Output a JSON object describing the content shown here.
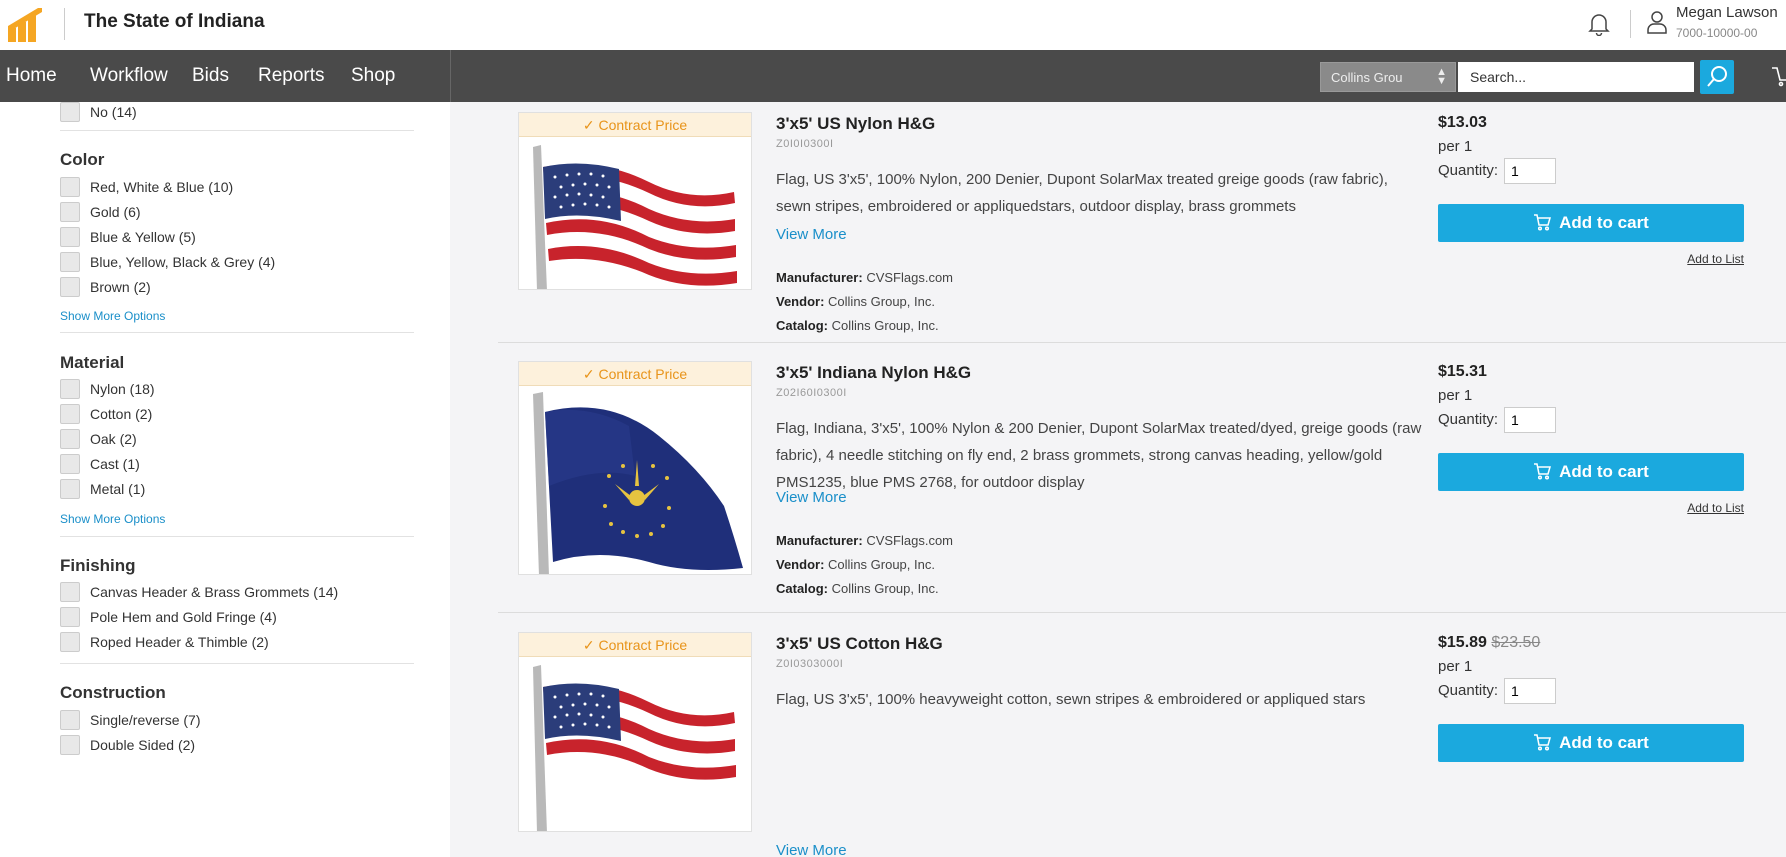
{
  "header": {
    "org_title": "The State of Indiana",
    "user_name": "Megan Lawson",
    "user_account": "7000-10000-00",
    "brand_color": "#f5a623"
  },
  "nav": {
    "items": [
      "Home",
      "Workflow",
      "Bids",
      "Reports",
      "Shop"
    ],
    "group_select": "Collins Grou",
    "search_placeholder": "Search..."
  },
  "filters": {
    "top_option": {
      "label": "No (14)"
    },
    "color": {
      "heading": "Color",
      "options": [
        "Red, White & Blue (10)",
        "Gold (6)",
        "Blue & Yellow (5)",
        "Blue, Yellow, Black & Grey (4)",
        "Brown (2)"
      ],
      "show_more": "Show More Options"
    },
    "material": {
      "heading": "Material",
      "options": [
        "Nylon (18)",
        "Cotton (2)",
        "Oak (2)",
        "Cast (1)",
        "Metal (1)"
      ],
      "show_more": "Show More Options"
    },
    "finishing": {
      "heading": "Finishing",
      "options": [
        "Canvas Header & Brass Grommets (14)",
        "Pole Hem and Gold Fringe (4)",
        "Roped Header & Thimble (2)"
      ]
    },
    "construction": {
      "heading": "Construction",
      "options": [
        "Single/reverse (7)",
        "Double Sided (2)"
      ]
    }
  },
  "common": {
    "badge": "Contract Price",
    "view_more": "View More",
    "quantity_label": "Quantity:",
    "add_to_cart": "Add to cart",
    "add_to_list": "Add to List",
    "manufacturer_label": "Manufacturer:",
    "vendor_label": "Vendor:",
    "catalog_label": "Catalog:",
    "accent_color": "#1ba9de"
  },
  "products": [
    {
      "title": "3'x5' US Nylon H&G",
      "code": "Z0I0I0300I",
      "description": "Flag, US 3'x5', 100% Nylon, 200 Denier, Dupont SolarMax treated greige goods (raw fabric), sewn stripes, embroidered or appliquedstars, outdoor display, brass grommets",
      "price": "$13.03",
      "old_price": "",
      "per": "per 1",
      "quantity": "1",
      "manufacturer": "CVSFlags.com",
      "vendor": "Collins Group, Inc.",
      "catalog": "Collins Group, Inc.",
      "image": "us-flag"
    },
    {
      "title": "3'x5' Indiana Nylon H&G",
      "code": "Z02I60I0300I",
      "description": "Flag, Indiana, 3'x5', 100% Nylon & 200 Denier, Dupont SolarMax treated/dyed, greige goods (raw fabric), 4 needle stitching on fly end, 2 brass grommets, strong canvas heading, yellow/gold PMS1235, blue PMS 2768, for outdoor display",
      "price": "$15.31",
      "old_price": "",
      "per": "per 1",
      "quantity": "1",
      "manufacturer": "CVSFlags.com",
      "vendor": "Collins Group, Inc.",
      "catalog": "Collins Group, Inc.",
      "image": "indiana-flag"
    },
    {
      "title": "3'x5' US Cotton H&G",
      "code": "Z0I0303000I",
      "description": "Flag, US 3'x5', 100% heavyweight cotton, sewn stripes & embroidered or appliqued stars",
      "price": "$15.89",
      "old_price": "$23.50",
      "per": "per 1",
      "quantity": "1",
      "image": "us-flag"
    }
  ]
}
